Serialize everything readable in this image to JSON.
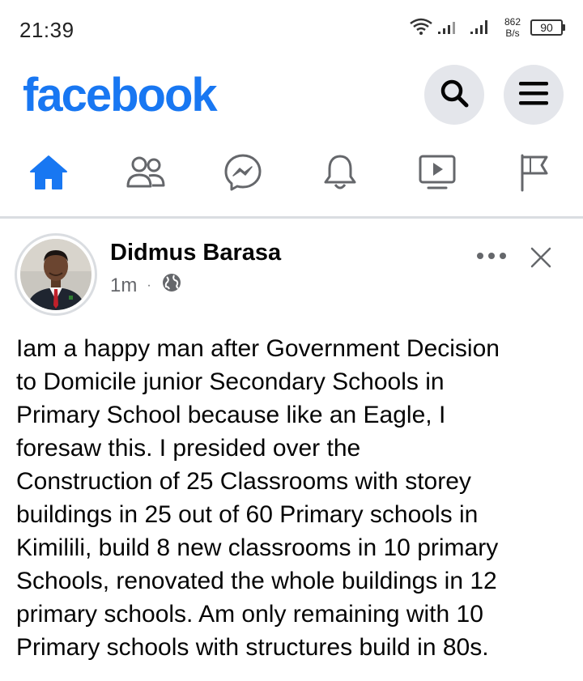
{
  "status_bar": {
    "time": "21:39",
    "net_speed_value": "862",
    "net_speed_unit": "B/s",
    "battery": "90"
  },
  "header": {
    "logo": "facebook",
    "brand_color": "#1877f2",
    "search_icon": "search-icon",
    "menu_icon": "hamburger-menu-icon"
  },
  "tabs": [
    {
      "name": "home-icon",
      "active": true
    },
    {
      "name": "friends-icon",
      "active": false
    },
    {
      "name": "messenger-icon",
      "active": false
    },
    {
      "name": "notifications-bell-icon",
      "active": false
    },
    {
      "name": "video-watch-icon",
      "active": false
    },
    {
      "name": "pages-flag-icon",
      "active": false
    }
  ],
  "post": {
    "author": "Didmus Barasa",
    "time": "1m",
    "separator": "·",
    "privacy_icon": "globe-icon",
    "text": "Iam a happy man after Government Decision\nto Domicile junior Secondary Schools in\nPrimary School because like an Eagle, I\nforesaw this. I presided over the\nConstruction of 25 Classrooms  with storey\nbuildings in 25 out of  60 Primary schools in\nKimilili, build 8 new classrooms in 10 primary\nSchools, renovated the whole buildings in 12\nprimary schools. Am only remaining with 10\nPrimary schools with structures build in 80s."
  }
}
